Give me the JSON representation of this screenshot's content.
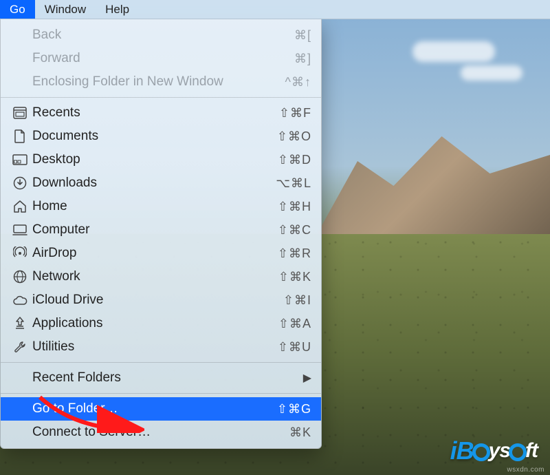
{
  "menubar": {
    "items": [
      {
        "label": "Go",
        "active": true
      },
      {
        "label": "Window",
        "active": false
      },
      {
        "label": "Help",
        "active": false
      }
    ]
  },
  "dropdown": {
    "section_nav": [
      {
        "label": "Back",
        "shortcut": "⌘[",
        "disabled": true
      },
      {
        "label": "Forward",
        "shortcut": "⌘]",
        "disabled": true
      },
      {
        "label": "Enclosing Folder in New Window",
        "shortcut": "^⌘↑",
        "disabled": true
      }
    ],
    "section_places": [
      {
        "icon": "recents-icon",
        "label": "Recents",
        "shortcut": "⇧⌘F"
      },
      {
        "icon": "documents-icon",
        "label": "Documents",
        "shortcut": "⇧⌘O"
      },
      {
        "icon": "desktop-icon",
        "label": "Desktop",
        "shortcut": "⇧⌘D"
      },
      {
        "icon": "downloads-icon",
        "label": "Downloads",
        "shortcut": "⌥⌘L"
      },
      {
        "icon": "home-icon",
        "label": "Home",
        "shortcut": "⇧⌘H"
      },
      {
        "icon": "computer-icon",
        "label": "Computer",
        "shortcut": "⇧⌘C"
      },
      {
        "icon": "airdrop-icon",
        "label": "AirDrop",
        "shortcut": "⇧⌘R"
      },
      {
        "icon": "network-icon",
        "label": "Network",
        "shortcut": "⇧⌘K"
      },
      {
        "icon": "icloud-icon",
        "label": "iCloud Drive",
        "shortcut": "⇧⌘I"
      },
      {
        "icon": "applications-icon",
        "label": "Applications",
        "shortcut": "⇧⌘A"
      },
      {
        "icon": "utilities-icon",
        "label": "Utilities",
        "shortcut": "⇧⌘U"
      }
    ],
    "section_recent": [
      {
        "label": "Recent Folders",
        "submenu": true
      }
    ],
    "section_actions": [
      {
        "label": "Go to Folder…",
        "shortcut": "⇧⌘G",
        "highlighted": true
      },
      {
        "label": "Connect to Server…",
        "shortcut": "⌘K",
        "highlighted": false
      }
    ]
  },
  "branding": {
    "logo_text_1": "iB",
    "logo_text_2": "ys",
    "logo_text_3": "ft",
    "watermark": "wsxdn.com"
  },
  "annotations": {
    "arrow_points_to": "Go to Folder…"
  }
}
